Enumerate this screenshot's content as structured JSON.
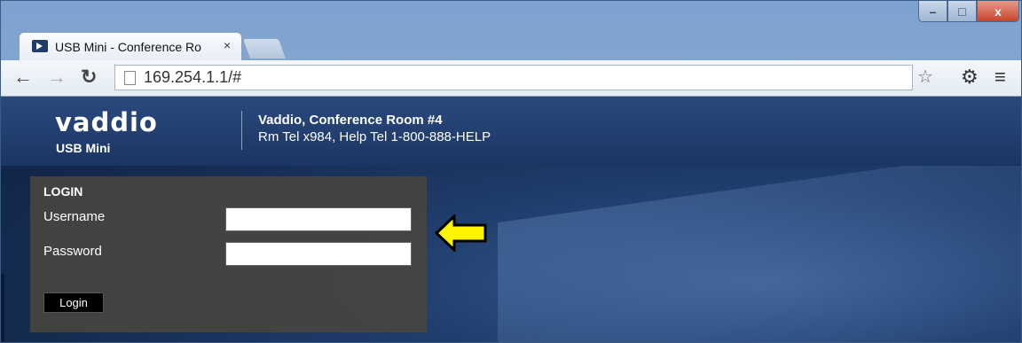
{
  "browser": {
    "tab_title": "USB Mini - Conference Ro",
    "tab_close": "×",
    "url": "169.254.1.1/#",
    "window_controls": {
      "minimize": "–",
      "maximize": "□",
      "close": "x"
    },
    "icons": [
      "back-icon",
      "forward-icon",
      "reload-icon",
      "page-icon",
      "star-icon",
      "gear-icon",
      "menu-icon"
    ]
  },
  "header": {
    "brand": "vaddio",
    "product": "USB Mini",
    "room_name": "Vaddio, Conference Room #4",
    "contact": "Rm Tel x984, Help Tel 1-800-888-HELP"
  },
  "login": {
    "title": "LOGIN",
    "username_label": "Username",
    "username_value": "",
    "password_label": "Password",
    "password_value": "",
    "button_label": "Login"
  },
  "colors": {
    "arrow_fill": "#FFF500",
    "login_panel": "#464440",
    "page_bg": "#13284B"
  }
}
